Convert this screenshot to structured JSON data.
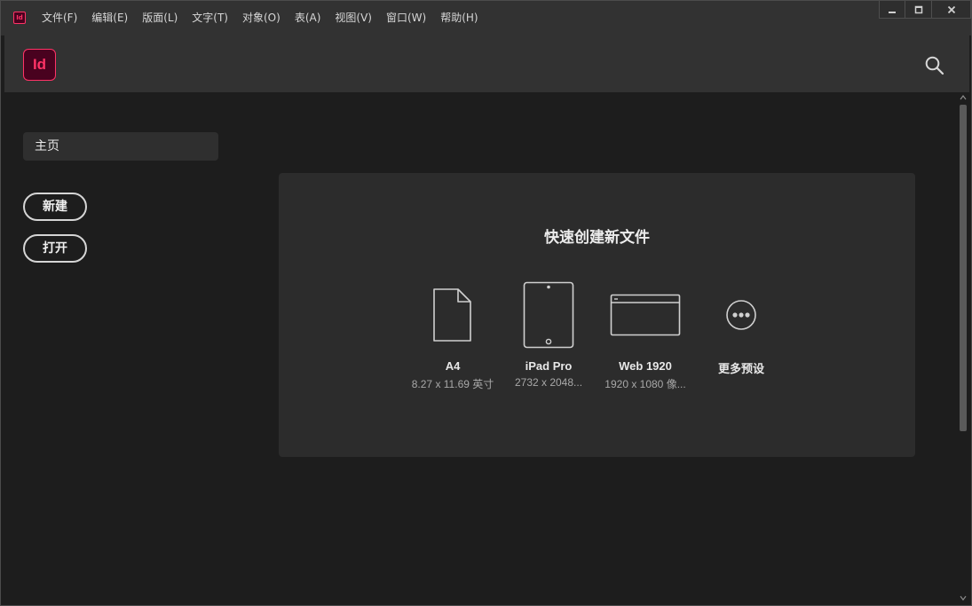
{
  "app": {
    "mini_logo": "Id",
    "logo": "Id",
    "accent": "#ff3366",
    "logo_bg": "#49021f"
  },
  "menu": [
    {
      "label": "文件(F)"
    },
    {
      "label": "编辑(E)"
    },
    {
      "label": "版面(L)"
    },
    {
      "label": "文字(T)"
    },
    {
      "label": "对象(O)"
    },
    {
      "label": "表(A)"
    },
    {
      "label": "视图(V)"
    },
    {
      "label": "窗口(W)"
    },
    {
      "label": "帮助(H)"
    }
  ],
  "sidebar": {
    "home_label": "主页",
    "new_label": "新建",
    "open_label": "打开"
  },
  "quick_create": {
    "title": "快速创建新文件",
    "presets": [
      {
        "name": "A4",
        "sub": "8.27 x 11.69 英寸",
        "icon": "document-icon"
      },
      {
        "name": "iPad Pro",
        "sub": "2732 x 2048...",
        "icon": "tablet-icon"
      },
      {
        "name": "Web 1920",
        "sub": "1920 x 1080 像...",
        "icon": "browser-window-icon"
      },
      {
        "name": "更多预设",
        "sub": "",
        "icon": "more-icon"
      }
    ]
  }
}
